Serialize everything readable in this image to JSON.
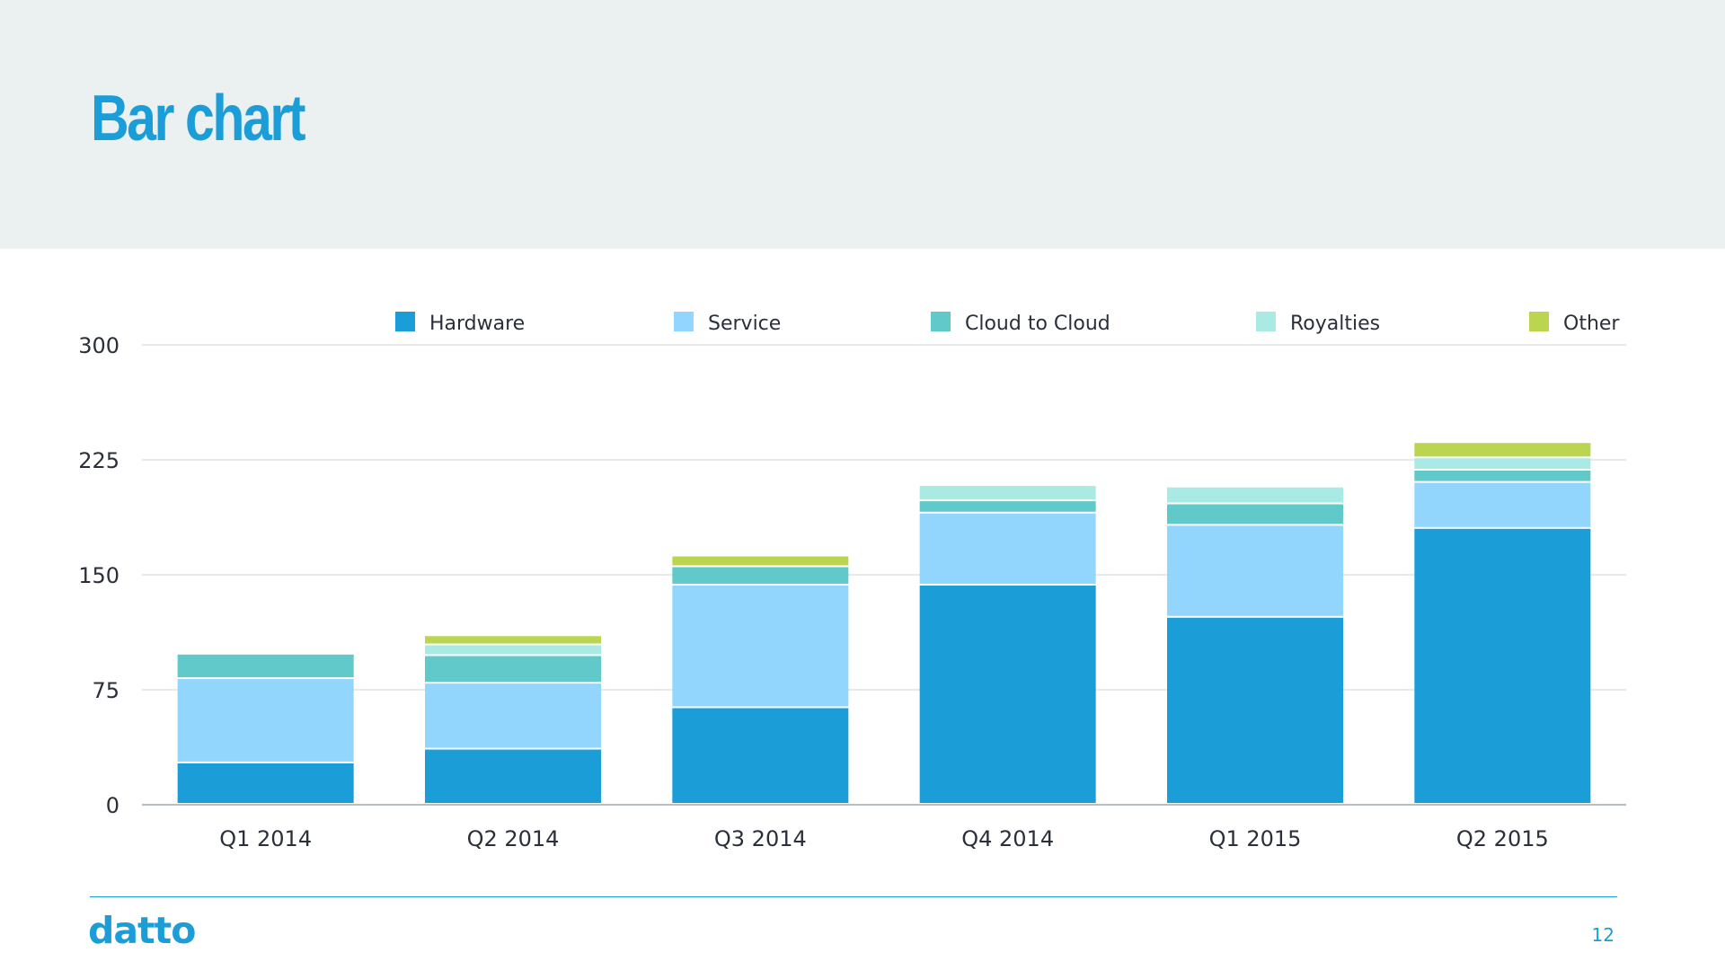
{
  "header": {
    "title": "Bar chart"
  },
  "footer": {
    "logo_text": "datto",
    "page_number": "12"
  },
  "chart_data": {
    "type": "bar",
    "stacked": true,
    "categories": [
      "Q1 2014",
      "Q2 2014",
      "Q3 2014",
      "Q4 2014",
      "Q1 2015",
      "Q2 2015"
    ],
    "ylim": [
      0,
      300
    ],
    "yticks": [
      0,
      75,
      150,
      225,
      300
    ],
    "grid": true,
    "legend_position": "top",
    "series": [
      {
        "name": "Hardware",
        "color": "#1b9ed8",
        "values": [
          27,
          36,
          63,
          143,
          122,
          180
        ]
      },
      {
        "name": "Service",
        "color": "#92d6fd",
        "values": [
          55,
          43,
          80,
          47,
          60,
          30
        ]
      },
      {
        "name": "Cloud to Cloud",
        "color": "#62c9cb",
        "values": [
          16,
          18,
          12,
          8,
          14,
          8
        ]
      },
      {
        "name": "Royalties",
        "color": "#aaeae5",
        "values": [
          0,
          7,
          0,
          10,
          11,
          8
        ]
      },
      {
        "name": "Other",
        "color": "#bcd551",
        "values": [
          0,
          6,
          7,
          0,
          0,
          10
        ]
      }
    ]
  }
}
